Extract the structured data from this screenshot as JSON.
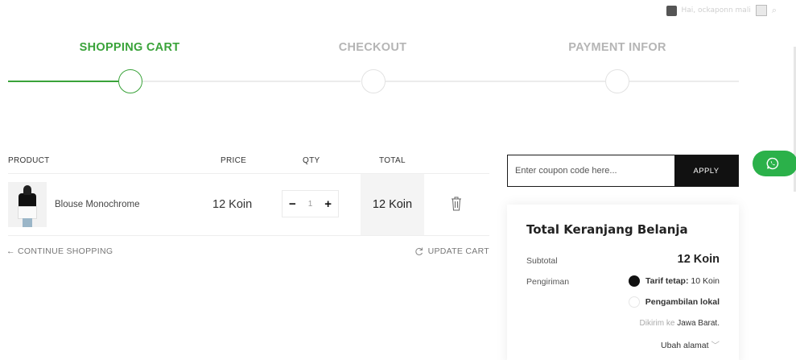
{
  "topbar": {
    "user_text": "Hai, ockaponn mali"
  },
  "steps": [
    {
      "label": "SHOPPING CART",
      "active": true
    },
    {
      "label": "CHECKOUT",
      "active": false
    },
    {
      "label": "PAYMENT INFOR",
      "active": false
    }
  ],
  "cart": {
    "headers": {
      "product": "PRODUCT",
      "price": "PRICE",
      "qty": "QTY",
      "total": "TOTAL"
    },
    "items": [
      {
        "name": "Blouse Monochrome",
        "price": "12 Koin",
        "qty": "1",
        "total": "12 Koin"
      }
    ],
    "continue_label": "← CONTINUE SHOPPING",
    "update_label": "UPDATE CART"
  },
  "coupon": {
    "placeholder": "Enter coupon code here...",
    "apply_label": "APPLY"
  },
  "totals": {
    "title": "Total Keranjang Belanja",
    "subtotal_label": "Subtotal",
    "subtotal_value": "12 Koin",
    "shipping_label": "Pengiriman",
    "shipping_options": [
      {
        "label": "Tarif tetap:",
        "value": "10 Koin",
        "selected": true
      },
      {
        "label": "Pengambilan lokal",
        "selected": false
      }
    ],
    "shipped_prefix": "Dikirim ke",
    "shipped_region": "Jawa Barat",
    "change_address": "Ubah alamat"
  },
  "colors": {
    "accent": "#3aa33a",
    "whatsapp": "#2bb14a",
    "dark": "#111111"
  },
  "icons": {
    "whatsapp": "whatsapp-icon",
    "trash": "trash-icon",
    "refresh": "refresh-icon"
  }
}
